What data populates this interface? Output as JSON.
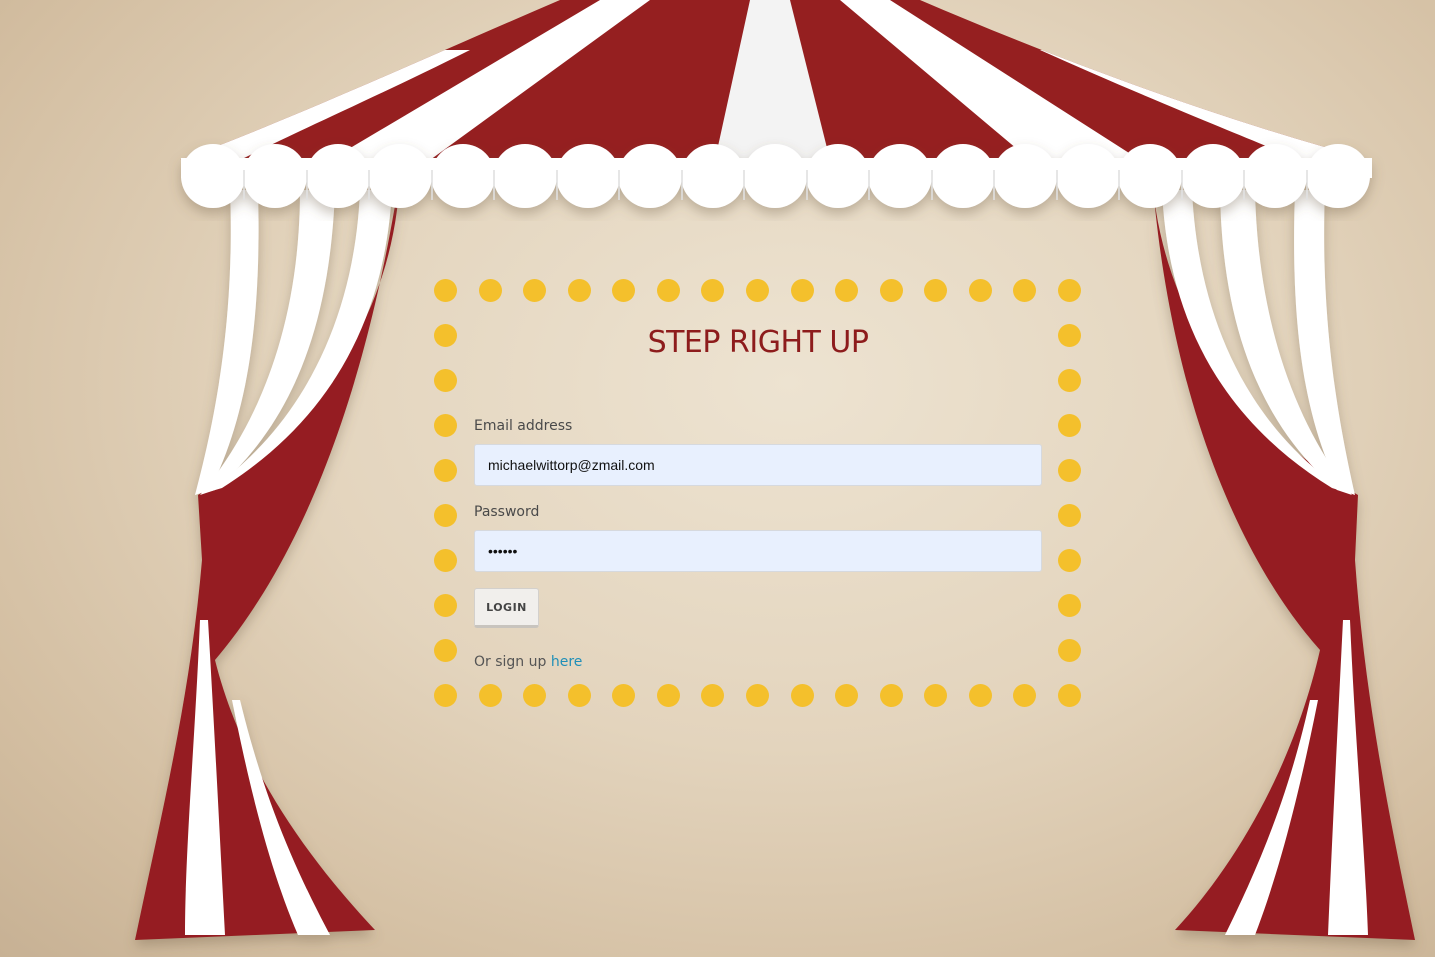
{
  "page": {
    "title": "STEP RIGHT UP"
  },
  "form": {
    "email_label": "Email address",
    "email_value": "michaelwittorp@zmail.com",
    "password_label": "Password",
    "password_value": "••••••",
    "login_label": "LOGIN",
    "signup_prefix": "Or sign up ",
    "signup_link": "here"
  },
  "theme": {
    "tent_red": "#951f20",
    "tent_white": "#ffffff",
    "bulb_yellow": "#f4c02c",
    "title_red": "#8d1c1c",
    "link_blue": "#1f8fb8",
    "input_bg": "#e8f0fe"
  },
  "icons": {
    "bulbs": "marquee-bulb"
  }
}
